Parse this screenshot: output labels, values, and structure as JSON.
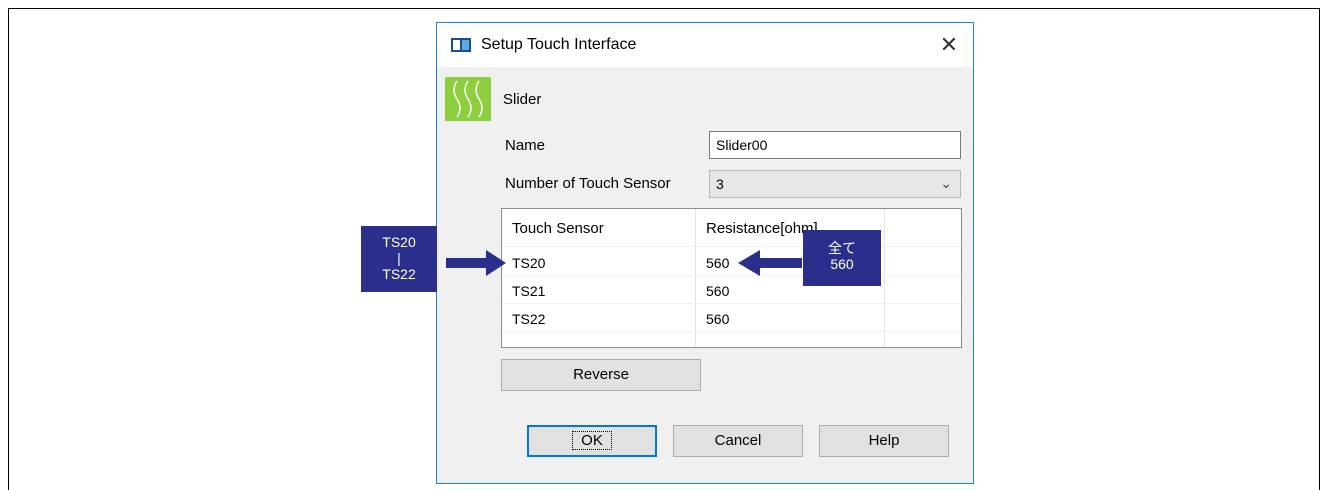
{
  "dialog": {
    "title": "Setup Touch Interface",
    "close_glyph": "✕",
    "type_label": "Slider",
    "name_label": "Name",
    "name_value": "Slider00",
    "sensor_count_label": "Number of Touch Sensor",
    "sensor_count_value": "3",
    "table": {
      "headers": [
        "Touch Sensor",
        "Resistance[ohm]"
      ],
      "rows": [
        {
          "sensor": "TS20",
          "resistance": "560"
        },
        {
          "sensor": "TS21",
          "resistance": "560"
        },
        {
          "sensor": "TS22",
          "resistance": "560"
        }
      ]
    },
    "reverse_label": "Reverse",
    "ok_label": "OK",
    "cancel_label": "Cancel",
    "help_label": "Help"
  },
  "annotations": {
    "left_callout": [
      "TS20",
      "|",
      "TS22"
    ],
    "right_callout": [
      "全て",
      "560"
    ]
  },
  "colors": {
    "callout": "#2b2f8c",
    "arrow": "#2b2f8c",
    "slider_icon": "#8dcf3f",
    "dialog_border": "#1e7fd6"
  },
  "icons": [
    "app-window-icon",
    "slider-icon",
    "close-icon",
    "chevron-down-icon"
  ]
}
